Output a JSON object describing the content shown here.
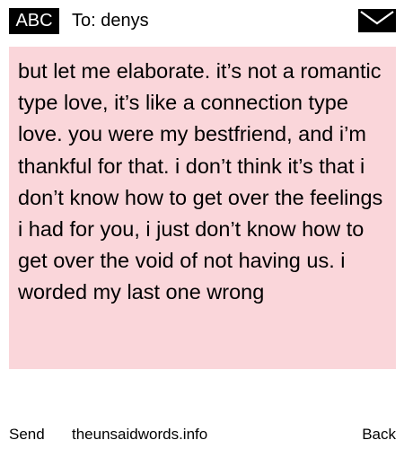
{
  "header": {
    "badge_label": "ABC",
    "recipient_line": "To: denys",
    "envelope_icon": "envelope-icon"
  },
  "message": {
    "body": "but let me elaborate. it’s not a romantic type love, it’s like a connection type love. you were my bestfriend, and i’m thankful for that. i don’t think it’s that i don’t know how to get over the feelings i had for you, i just don’t know how to get over the void of not having us. i worded my last one wrong"
  },
  "footer": {
    "send_label": "Send",
    "site_label": "theunsaidwords.info",
    "back_label": "Back"
  },
  "colors": {
    "message_background": "#fad6da",
    "badge_background": "#000000",
    "text": "#000000"
  }
}
